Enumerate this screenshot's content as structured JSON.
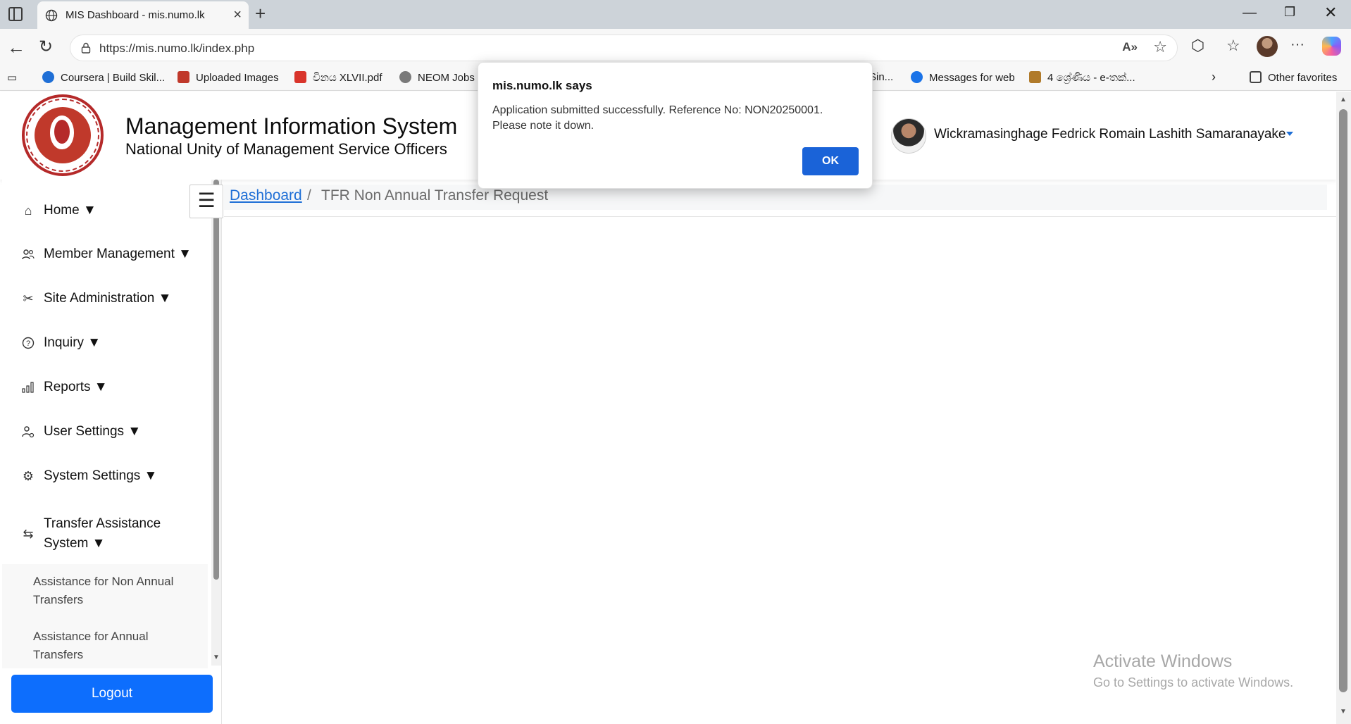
{
  "browser": {
    "tab_title": "MIS Dashboard - mis.numo.lk",
    "url": "https://mis.numo.lk/index.php",
    "bookmarks": [
      {
        "label": "Coursera | Build Skil...",
        "color": "#1f6fd6"
      },
      {
        "label": "Uploaded Images",
        "color": "#c0392b"
      },
      {
        "label": "විනය XLVII.pdf",
        "color": "#d9342b"
      },
      {
        "label": "NEOM Jobs",
        "color": "#7a7a7a"
      },
      {
        "label": "Sin...",
        "color": "#999999"
      },
      {
        "label": "Messages for web",
        "color": "#1a73e8"
      },
      {
        "label": "4 ශ්‍රේණිය - e-තක්...",
        "color": "#b07a2a"
      }
    ],
    "other_favorites": "Other favorites"
  },
  "header": {
    "title": "Management Information System",
    "subtitle": "National Unity of Management Service Officers",
    "user_name": "Wickramasinghage Fedrick Romain Lashith Samaranayake"
  },
  "sidebar": {
    "items": [
      {
        "label": "Home ▼",
        "icon": "home-icon"
      },
      {
        "label": "Member Management ▼",
        "icon": "users-icon"
      },
      {
        "label": "Site Administration ▼",
        "icon": "tools-icon"
      },
      {
        "label": "Inquiry ▼",
        "icon": "question-icon"
      },
      {
        "label": "Reports ▼",
        "icon": "bar-chart-icon"
      },
      {
        "label": "User Settings ▼",
        "icon": "user-gear-icon"
      },
      {
        "label": "System Settings ▼",
        "icon": "gear-icon"
      },
      {
        "label": "Transfer Assistance System ▼",
        "icon": "transfer-icon"
      }
    ],
    "subitems": [
      {
        "label": "Assistance for Non Annual Transfers"
      },
      {
        "label": "Assistance for Annual Transfers"
      }
    ],
    "logout_label": "Logout"
  },
  "breadcrumb": {
    "link": "Dashboard",
    "separator": "/",
    "current": "TFR Non Annual Transfer Request"
  },
  "dialog": {
    "title": "mis.numo.lk says",
    "message": "Application submitted successfully. Reference No: NON20250001. Please note it down.",
    "ok_label": "OK"
  },
  "watermark": {
    "title": "Activate Windows",
    "subtitle": "Go to Settings to activate Windows."
  },
  "colors": {
    "primary": "#0d6efd",
    "link": "#1f6fd6",
    "logo_red": "#b52a2a"
  }
}
